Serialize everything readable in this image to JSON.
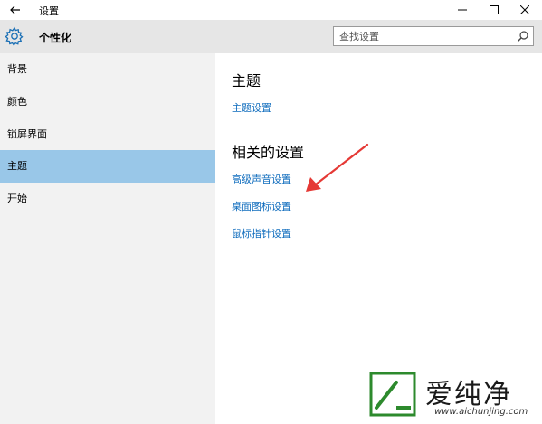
{
  "window": {
    "title": "设置",
    "back_icon": "back-arrow-icon",
    "minimize_icon": "minimize-icon",
    "maximize_icon": "maximize-icon",
    "close_icon": "close-icon"
  },
  "header": {
    "icon": "gear-icon",
    "title": "个性化",
    "search": {
      "placeholder": "查找设置",
      "icon": "search-icon"
    }
  },
  "sidebar": {
    "items": [
      {
        "label": "背景",
        "active": false
      },
      {
        "label": "颜色",
        "active": false
      },
      {
        "label": "锁屏界面",
        "active": false
      },
      {
        "label": "主题",
        "active": true
      },
      {
        "label": "开始",
        "active": false
      }
    ]
  },
  "content": {
    "theme_section": {
      "title": "主题",
      "links": [
        "主题设置"
      ]
    },
    "related_section": {
      "title": "相关的设置",
      "links": [
        "高级声音设置",
        "桌面图标设置",
        "鼠标指针设置"
      ]
    }
  },
  "annotation": {
    "arrow_color": "#e53935"
  },
  "watermark": {
    "text": "爱纯净",
    "url": "www.aichunjing.com"
  },
  "colors": {
    "accent": "#99c7e8",
    "link": "#0f6cbd",
    "sidebar_bg": "#f2f2f2",
    "header_bg": "#e6e6e6"
  }
}
